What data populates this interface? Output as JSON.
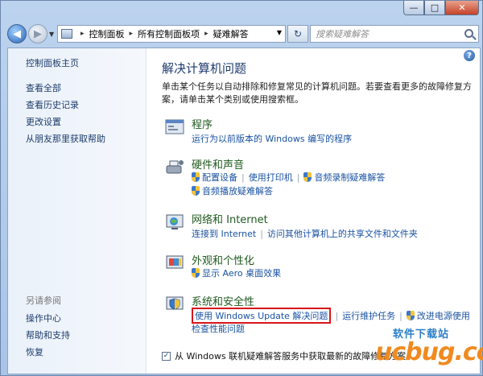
{
  "window": {
    "minimize": "—",
    "maximize": "□",
    "close": "✕"
  },
  "nav": {
    "back": "◀",
    "forward": "▶",
    "breadcrumbs": [
      "控制面板",
      "所有控制面板项",
      "疑难解答"
    ],
    "refresh": "↻",
    "search_placeholder": "搜索疑难解答"
  },
  "sidebar": {
    "items": [
      "控制面板主页",
      "查看全部",
      "查看历史记录",
      "更改设置",
      "从朋友那里获取帮助"
    ],
    "see_also_label": "另请参阅",
    "see_also": [
      "操作中心",
      "帮助和支持",
      "恢复"
    ]
  },
  "main": {
    "help": "?",
    "title": "解决计算机问题",
    "description": "单击某个任务以自动排除和修复常见的计算机问题。若要查看更多的故障修复方案，请单击某个类别或使用搜索框。",
    "categories": [
      {
        "title": "程序",
        "icon": "programs-icon",
        "rows": [
          [
            "运行为以前版本的 Windows 编写的程序"
          ]
        ]
      },
      {
        "title": "硬件和声音",
        "icon": "hardware-sound-icon",
        "rows": [
          [
            "配置设备",
            "使用打印机",
            "音频录制疑难解答"
          ],
          [
            "音频播放疑难解答"
          ]
        ]
      },
      {
        "title": "网络和 Internet",
        "icon": "network-icon",
        "rows": [
          [
            "连接到 Internet",
            "访问其他计算机上的共享文件和文件夹"
          ]
        ]
      },
      {
        "title": "外观和个性化",
        "icon": "appearance-icon",
        "rows": [
          [
            "显示 Aero 桌面效果"
          ]
        ]
      },
      {
        "title": "系统和安全性",
        "icon": "system-security-icon",
        "rows": [
          [
            "使用 Windows Update 解决问题",
            "运行维护任务",
            "改进电源使用"
          ],
          [
            "检查性能问题"
          ]
        ]
      }
    ],
    "online_checkbox": "从 Windows 联机疑难解答服务中获取最新的故障修复方案",
    "online_checked": true
  },
  "watermark": {
    "top": "软件下载站",
    "bottom": "ucbug.cc"
  },
  "colors": {
    "highlight": "#d8151b",
    "link": "#1a52a2",
    "category_title": "#1f5a1f"
  }
}
